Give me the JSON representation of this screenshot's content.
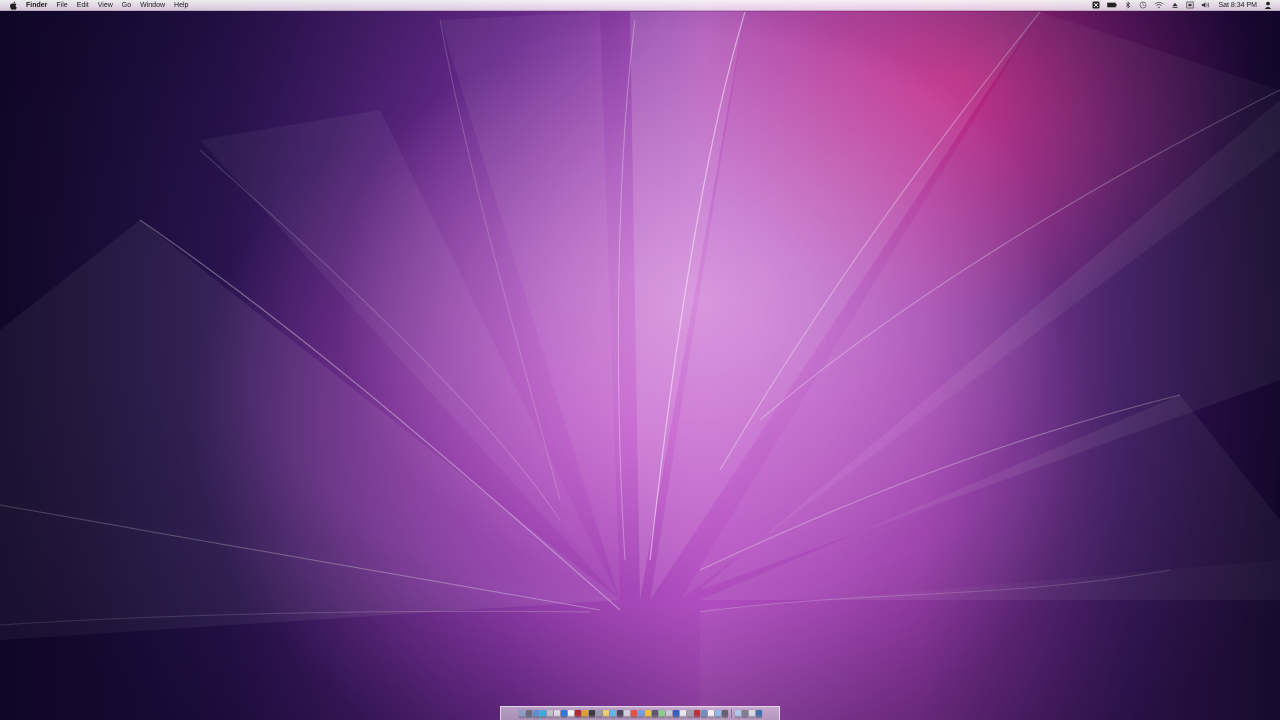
{
  "menubar": {
    "app_name": "Finder",
    "menus": [
      "File",
      "Edit",
      "View",
      "Go",
      "Window",
      "Help"
    ],
    "status_icons": [
      "timemachine-icon",
      "battery-icon",
      "bluetooth-icon",
      "clock-sync-icon",
      "wifi-icon",
      "eject-icon",
      "display-icon",
      "volume-icon"
    ],
    "clock": "Sat 8:34 PM",
    "user_icon": "user-icon"
  },
  "dock": {
    "icon_colors": [
      "#8aa0c8",
      "#6b6b78",
      "#5b8fd6",
      "#3fa9e0",
      "#c0c0c8",
      "#d9d9e0",
      "#2f7ad6",
      "#f0f0f0",
      "#b32a2a",
      "#e0a030",
      "#3a3a44",
      "#9a9aa8",
      "#e8d070",
      "#60b8f0",
      "#4a4a5a",
      "#d0d0d8",
      "#e85040",
      "#70a0e0",
      "#f0c040",
      "#5a5a6a",
      "#8ad08a",
      "#c8c8d0",
      "#3060c0",
      "#e8e8f0",
      "#a0a0b0",
      "#c03030",
      "#7090c0",
      "#f0f0f5",
      "#90b8e8",
      "#606070",
      "#b0c8e8",
      "#808090",
      "#d8d8e0",
      "#4070b0"
    ],
    "separator_after": 30
  },
  "colors": {
    "accent": "#a44bb7",
    "highlight": "#dc2882"
  }
}
